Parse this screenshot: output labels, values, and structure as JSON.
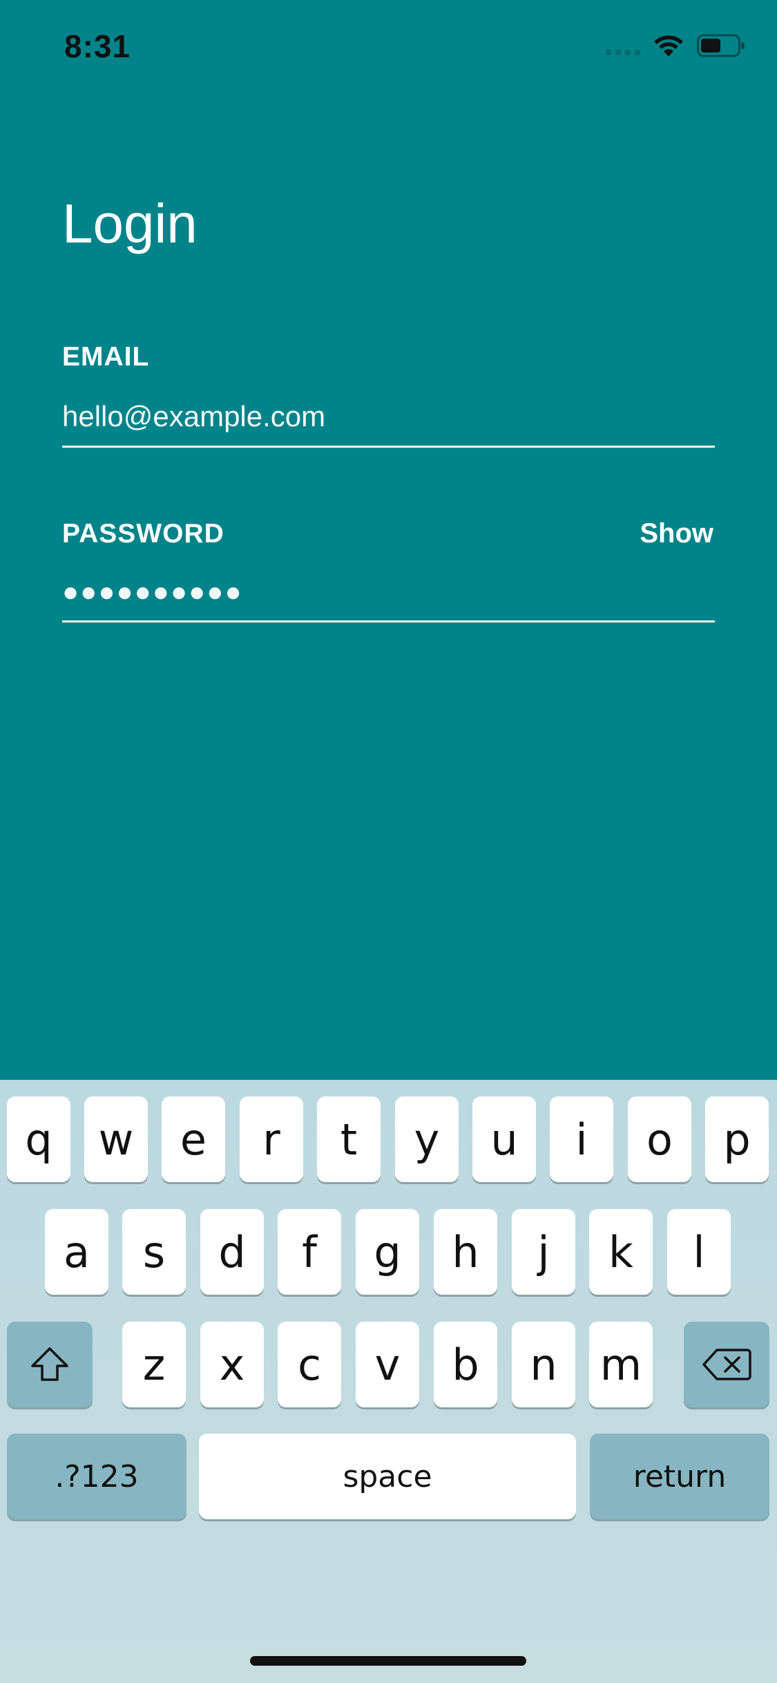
{
  "status_bar": {
    "time": "8:31"
  },
  "colors": {
    "background": "#00848a",
    "keyboard_bg": "#bcd9df",
    "special_key": "#87b6c2"
  },
  "page": {
    "title": "Login"
  },
  "form": {
    "email": {
      "label": "EMAIL",
      "value": "hello@example.com"
    },
    "password": {
      "label": "PASSWORD",
      "toggle_label": "Show",
      "masked_value": "●●●●●●●●●●"
    }
  },
  "keyboard": {
    "row1": [
      "q",
      "w",
      "e",
      "r",
      "t",
      "y",
      "u",
      "i",
      "o",
      "p"
    ],
    "row2": [
      "a",
      "s",
      "d",
      "f",
      "g",
      "h",
      "j",
      "k",
      "l"
    ],
    "row3": [
      "z",
      "x",
      "c",
      "v",
      "b",
      "n",
      "m"
    ],
    "numbers_label": ".?123",
    "space_label": "space",
    "return_label": "return",
    "shift_icon": "shift-icon",
    "delete_icon": "backspace-icon"
  }
}
